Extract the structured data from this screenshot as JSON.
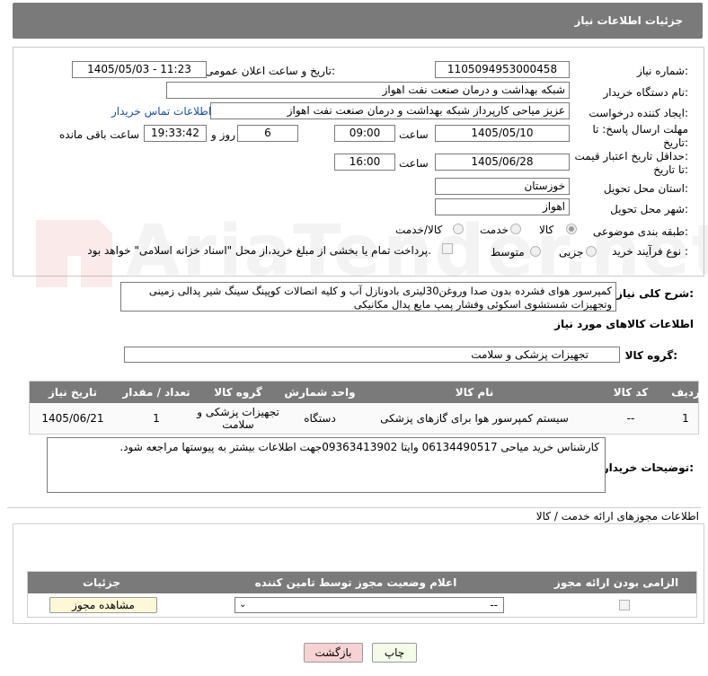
{
  "header": {
    "title": "جزئیات اطلاعات نیاز"
  },
  "form": {
    "need_number_label": "شماره نیاز:",
    "need_number": "1105094953000458",
    "announce_label": "تاریخ و ساعت اعلان عمومی:",
    "announce_value": "1405/05/03 - 11:23",
    "buyer_label": "نام دستگاه خریدار:",
    "buyer_value": "شبکه بهداشت و درمان صنعت نفت اهواز",
    "creator_label": "ایجاد کننده درخواست:",
    "creator_value": "عزیز میاحی کارپرداز شبکه بهداشت و درمان صنعت نفت اهواز",
    "contact_link": "اطلاعات تماس خریدار",
    "deadline_label_1": "مهلت ارسال پاسخ: تا",
    "deadline_label_2": "تاریخ:",
    "deadline_date": "1405/05/10",
    "time_label": "ساعت",
    "deadline_time": "09:00",
    "days_value": "6",
    "days_label": "روز و",
    "remaining_time": "19:33:42",
    "remaining_label": "ساعت باقی مانده",
    "validity_label_1": "حداقل تاریخ اعتبار قیمت:",
    "validity_label_2": "تا تاریخ:",
    "validity_date": "1405/06/28",
    "validity_time": "16:00",
    "province_label": "استان محل تحویل:",
    "province_value": "خوزستان",
    "city_label": "شهر محل تحویل:",
    "city_value": "اهواز",
    "category_label": "طبقه بندی موضوعی:",
    "category_options": [
      "کالا",
      "خدمت",
      "کالا/خدمت"
    ],
    "category_selected": "کالا",
    "process_label": "نوع فرآیند خرید :",
    "process_options": [
      "جزیی",
      "متوسط"
    ],
    "payment_note": "پرداخت تمام یا بخشی از مبلغ خرید،از محل \"اسناد خزانه اسلامی\" خواهد بود."
  },
  "description": {
    "label": "شرح کلی نیاز:",
    "text": "کمپرسور هوای فشرده بدون صدا وروغن30لیتری بادونازل آب و کلیه اتصالات کوپینگ  سینگ شیر پدالی  زمینی وتجهیزات شستشوی اسکوئی وفشار پمپ مایع پدال مکانیکی"
  },
  "goods": {
    "section_title": "اطلاعات کالاهای مورد نیاز",
    "group_label": "گروه کالا:",
    "group_value": "تجهیزات پزشکی و سلامت",
    "columns": [
      "ردیف",
      "کد کالا",
      "نام کالا",
      "واحد شمارش",
      "گروه کالا",
      "تعداد / مقدار",
      "تاریخ نیاز"
    ],
    "rows": [
      [
        "1",
        "--",
        "سیستم کمپرسور هوا برای گازهای پزشکی",
        "دستگاه",
        "تجهیزات پزشکی و سلامت",
        "1",
        "1405/06/21"
      ]
    ]
  },
  "buyer_notes": {
    "label": "توضیحات خریدار:",
    "text": "کارشناس خرید میاحی 06134490517 وایتا 09363413902جهت اطلاعات بیشتر به پیوستها مراجعه شود."
  },
  "permits": {
    "section_title": "اطلاعات مجوزهای ارائه خدمت / کالا",
    "columns": [
      "الزامی بودن ارائه مجوز",
      "اعلام وضعیت مجوز توسط تامین کننده",
      "جزئیات"
    ],
    "select_value": "--",
    "view_button": "مشاهده مجوز"
  },
  "footer": {
    "print_button": "چاپ",
    "back_button": "بازگشت"
  },
  "watermark": {
    "text": "AriaTender.net"
  },
  "colors": {
    "header_bg": "#7a7a7a",
    "link": "#1a4fa3",
    "back_button_bg": "#f6d2d2"
  }
}
